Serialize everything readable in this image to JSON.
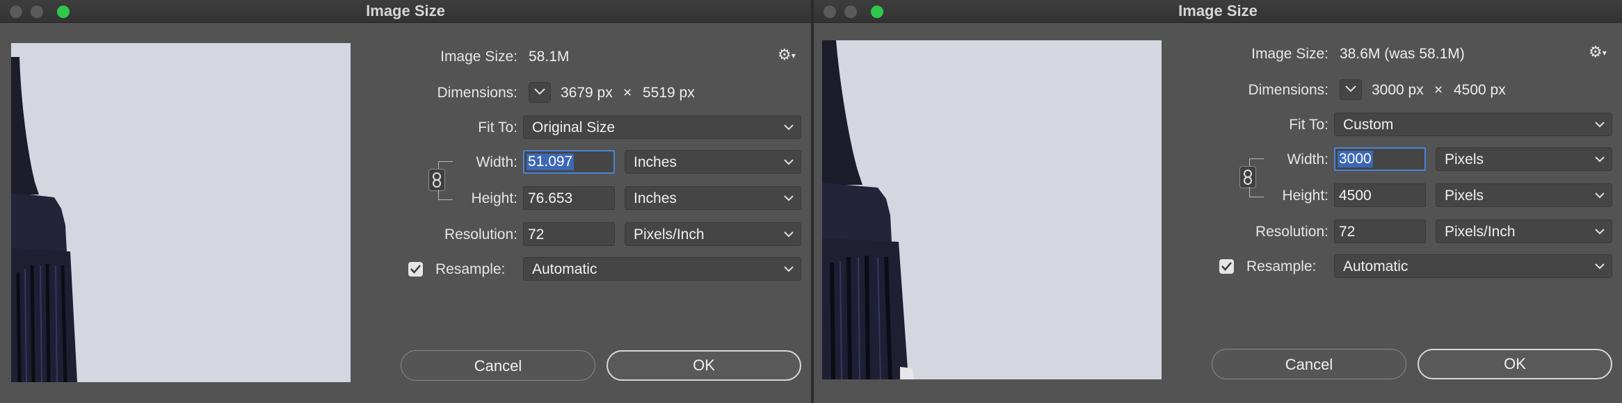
{
  "left": {
    "title": "Image Size",
    "image_size_label": "Image Size:",
    "image_size_value": "58.1M",
    "dimensions_label": "Dimensions:",
    "dimensions_width": "3679 px",
    "dimensions_x": "×",
    "dimensions_height": "5519 px",
    "fit_to_label": "Fit To:",
    "fit_to_value": "Original Size",
    "width_label": "Width:",
    "width_value": "51.097",
    "width_unit": "Inches",
    "height_label": "Height:",
    "height_value": "76.653",
    "height_unit": "Inches",
    "resolution_label": "Resolution:",
    "resolution_value": "72",
    "resolution_unit": "Pixels/Inch",
    "resample_label": "Resample:",
    "resample_checked": true,
    "resample_value": "Automatic",
    "cancel_label": "Cancel",
    "ok_label": "OK"
  },
  "right": {
    "title": "Image Size",
    "image_size_label": "Image Size:",
    "image_size_value": "38.6M (was 58.1M)",
    "dimensions_label": "Dimensions:",
    "dimensions_width": "3000 px",
    "dimensions_x": "×",
    "dimensions_height": "4500 px",
    "fit_to_label": "Fit To:",
    "fit_to_value": "Custom",
    "width_label": "Width:",
    "width_value": "3000",
    "width_unit": "Pixels",
    "height_label": "Height:",
    "height_value": "4500",
    "height_unit": "Pixels",
    "resolution_label": "Resolution:",
    "resolution_value": "72",
    "resolution_unit": "Pixels/Inch",
    "resample_label": "Resample:",
    "resample_checked": true,
    "resample_value": "Automatic",
    "cancel_label": "Cancel",
    "ok_label": "OK"
  },
  "icons": {
    "gear": "gear-icon",
    "chain": "link-icon",
    "chevron": "chevron-down-icon",
    "check": "checkmark-icon"
  },
  "colors": {
    "dialog_bg": "#535353",
    "titlebar_bg": "#363636",
    "field_bg": "#454545",
    "selection": "#3b67b5",
    "focus_ring": "#4a83d6",
    "maximize_green": "#2fc84b"
  }
}
